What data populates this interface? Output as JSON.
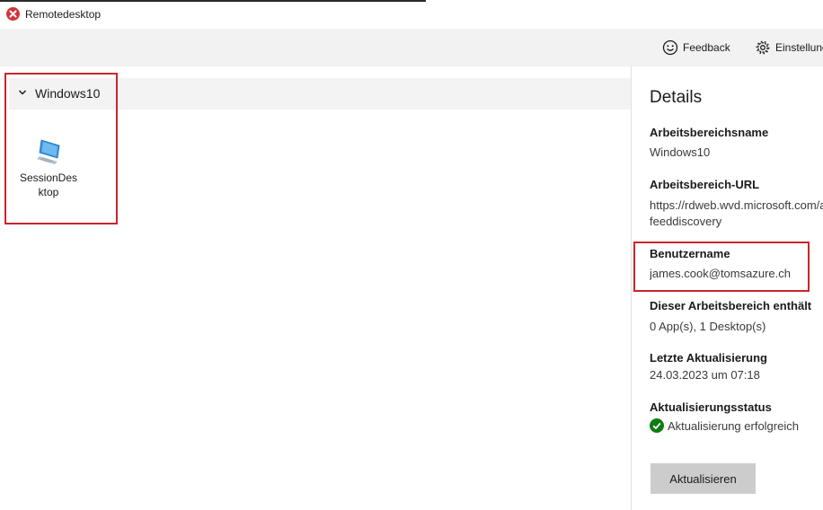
{
  "window": {
    "title": "Remotedesktop"
  },
  "toolbar": {
    "feedback_label": "Feedback",
    "settings_label": "Einstellungen"
  },
  "workspace": {
    "group_name": "Windows10",
    "tiles": [
      {
        "name_line1": "SessionDes",
        "name_line2": "ktop"
      }
    ]
  },
  "details": {
    "heading": "Details",
    "workspace_name_label": "Arbeitsbereichsname",
    "workspace_name_value": "Windows10",
    "url_label": "Arbeitsbereich-URL",
    "url_value_line1": "https://rdweb.wvd.microsoft.com/api/arm/",
    "url_value_line2": "feeddiscovery",
    "username_label": "Benutzername",
    "username_value": "james.cook@tomsazure.ch",
    "contains_label": "Dieser Arbeitsbereich enthält",
    "contains_value": "0 App(s), 1 Desktop(s)",
    "last_update_label": "Letzte Aktualisierung",
    "last_update_value": "24.03.2023 um 07:18",
    "status_label": "Aktualisierungsstatus",
    "status_value": "Aktualisierung erfolgreich",
    "refresh_button": "Aktualisieren"
  },
  "colors": {
    "highlight": "#c8262b",
    "success": "#107c10",
    "button_bg": "#cccccc"
  }
}
